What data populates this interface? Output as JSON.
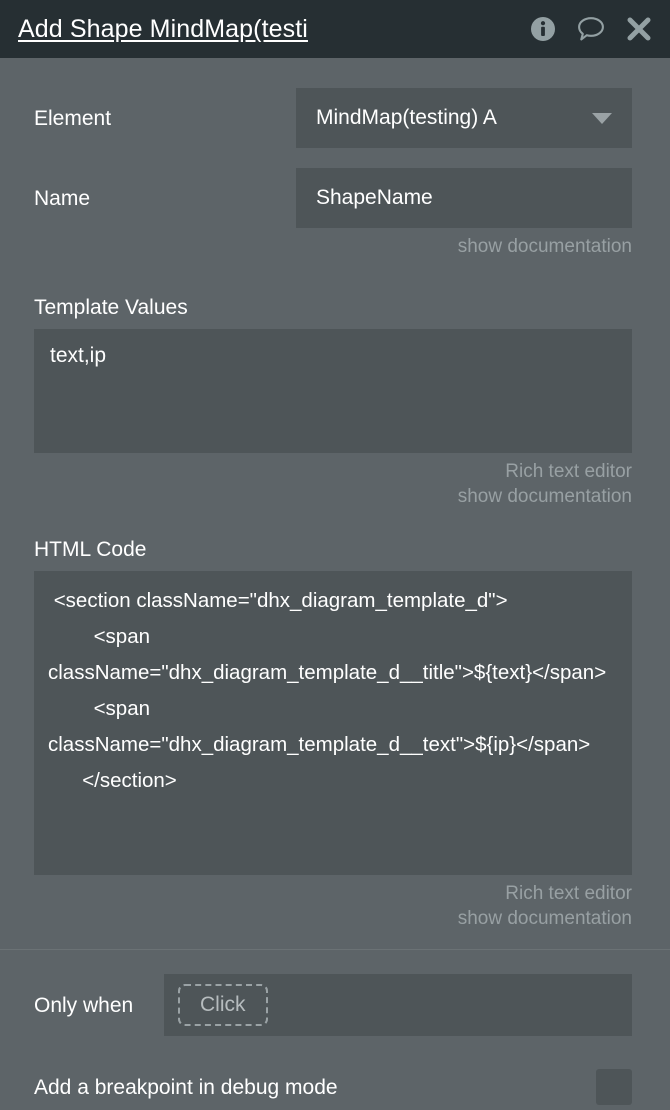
{
  "titlebar": {
    "title": "Add Shape MindMap(testi",
    "actions": [
      {
        "name": "info-icon",
        "label": "info"
      },
      {
        "name": "comment-icon",
        "label": "comment"
      },
      {
        "name": "close-icon",
        "label": "close"
      }
    ]
  },
  "form": {
    "element": {
      "label": "Element",
      "value": "MindMap(testing) A"
    },
    "name": {
      "label": "Name",
      "value": "ShapeName",
      "hint": "show documentation"
    },
    "template_values": {
      "label": "Template Values",
      "value": "text,ip",
      "hint_editor": "Rich text editor",
      "hint_docs": "show documentation"
    },
    "html_code": {
      "label": "HTML Code",
      "value": " <section className=\"dhx_diagram_template_d\">\n        <span className=\"dhx_diagram_template_d__title\">${text}</span>\n        <span className=\"dhx_diagram_template_d__text\">${ip}</span>\n      </section>",
      "hint_editor": "Rich text editor",
      "hint_docs": "show documentation"
    },
    "only_when": {
      "label": "Only when",
      "placeholder": "Click"
    },
    "breakpoint": {
      "label": "Add a breakpoint in debug mode",
      "checked": false
    }
  },
  "colors": {
    "header_bg": "#262f33",
    "page_bg": "#5d6468",
    "field_bg": "#4e5558",
    "text": "#ffffff",
    "muted": "#98a0a3"
  }
}
